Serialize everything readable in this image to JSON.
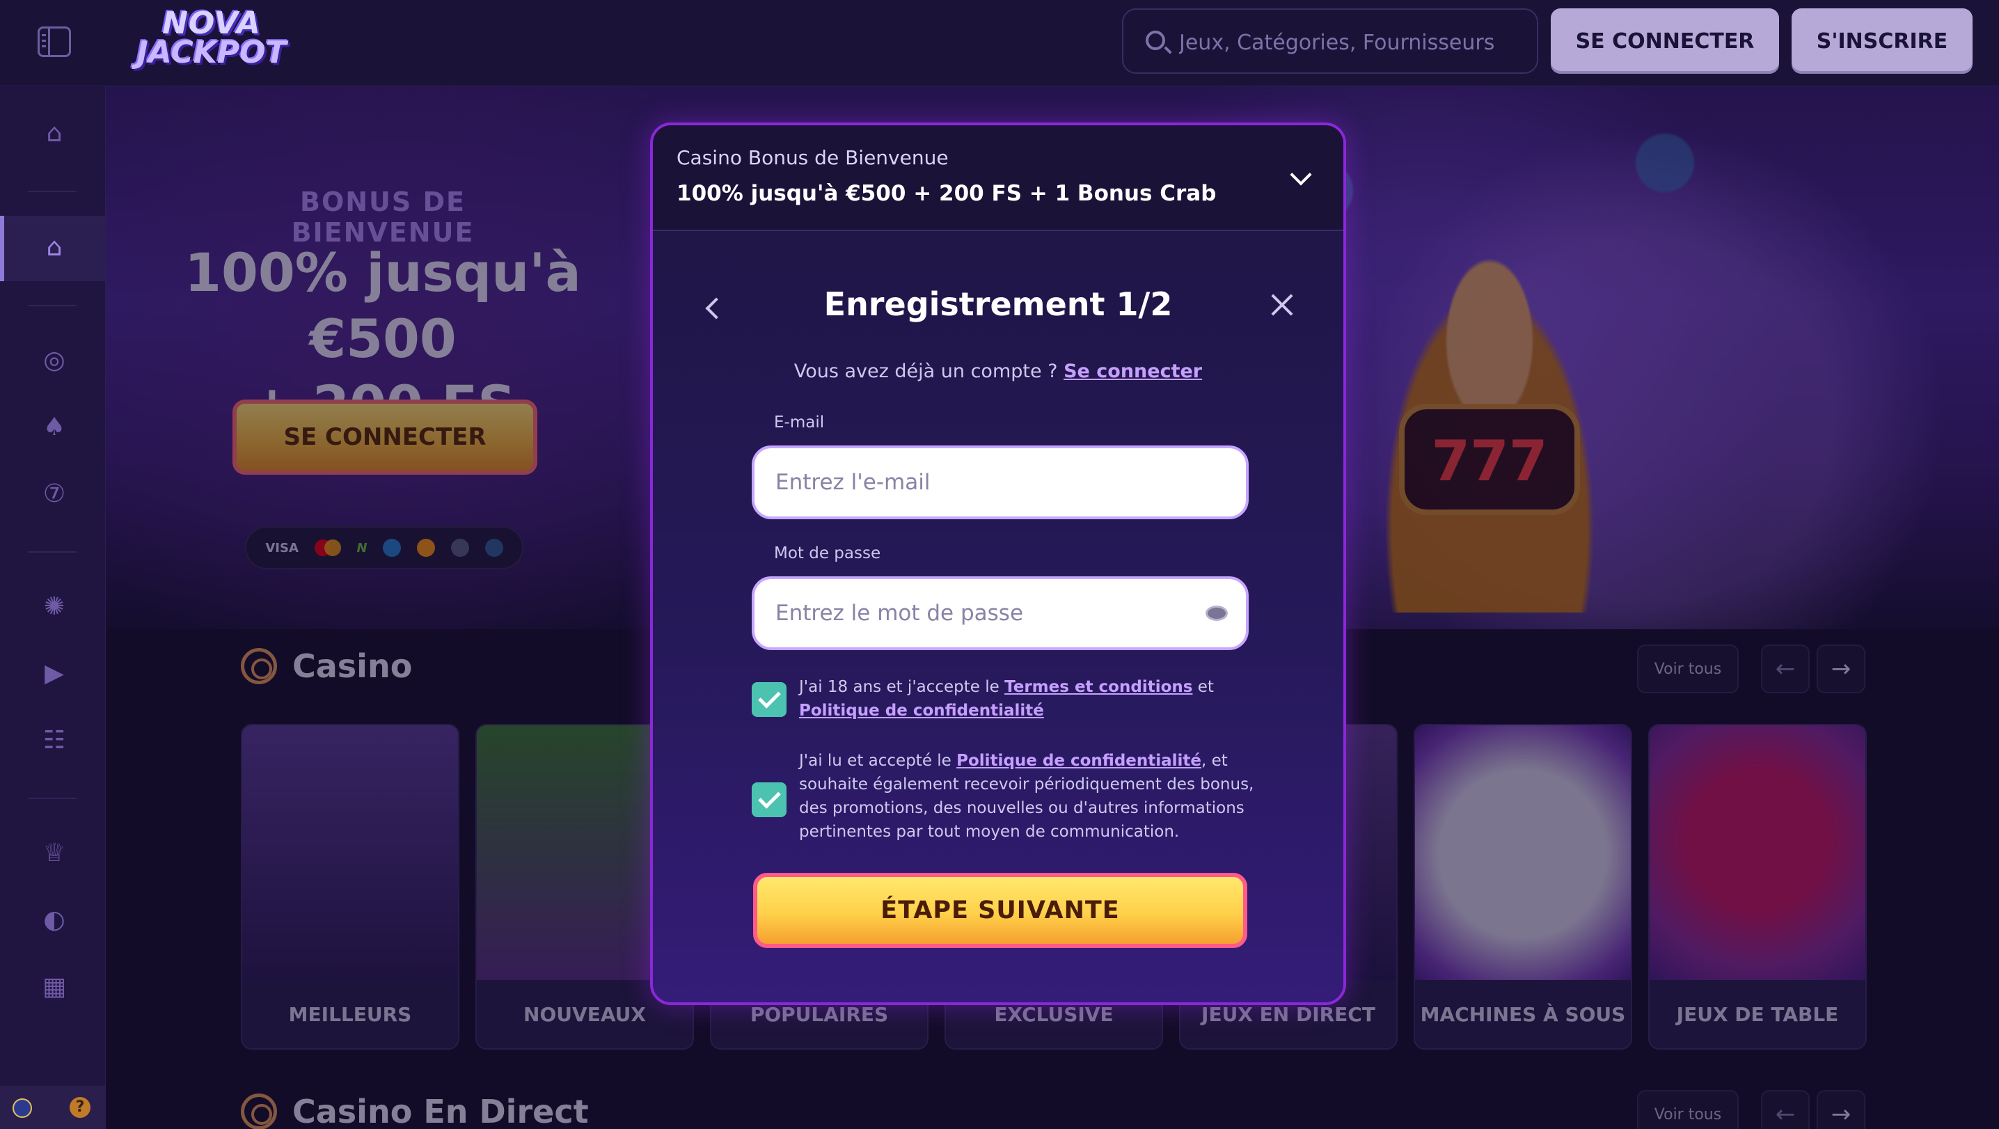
{
  "header": {
    "logo_line1": "NOVA",
    "logo_line2": "JACKPOT",
    "search_placeholder": "Jeux, Catégories, Fournisseurs",
    "login_label": "SE CONNECTER",
    "signup_label": "S'INSCRIRE"
  },
  "hero": {
    "bonus_title": "BONUS DE BIENVENUE",
    "bonus_amount_line1": "100% jusqu'à €500",
    "bonus_amount_line2": "+ 200 FS",
    "cta_label": "SE CONNECTER",
    "payments": [
      "VISA",
      "N"
    ],
    "slot_display": "777"
  },
  "sections": {
    "casino_title": "Casino",
    "live_title": "Casino En Direct",
    "see_all": "Voir tous"
  },
  "cards": [
    {
      "label": "MEILLEURS"
    },
    {
      "label": "NOUVEAUX"
    },
    {
      "label": "POPULAIRES"
    },
    {
      "label": "EXCLUSIVE"
    },
    {
      "label": "JEUX EN DIRECT"
    },
    {
      "label": "MACHINES À SOUS"
    },
    {
      "label": "JEUX DE TABLE"
    }
  ],
  "modal": {
    "bonus_label": "Casino Bonus de Bienvenue",
    "bonus_value": "100% jusqu'à €500 + 200 FS + 1 Bonus Crab",
    "title": "Enregistrement 1/2",
    "have_account": "Vous avez déjà un compte ?",
    "have_account_link": "Se connecter",
    "email_label": "E-mail",
    "email_placeholder": "Entrez l'e-mail",
    "password_label": "Mot de passe",
    "password_placeholder": "Entrez le mot de passe",
    "consent1_pre": "J'ai 18 ans et j'accepte le",
    "consent1_link1": "Termes et conditions",
    "consent1_mid": "et",
    "consent1_link2": "Politique de confidentialité",
    "consent2_pre": "J'ai lu et accepté le",
    "consent2_link": "Politique de confidentialité",
    "consent2_post": ", et souhaite également recevoir périodiquement des bonus, des promotions, des nouvelles ou d'autres informations pertinentes par tout moyen de communication.",
    "next_label": "ÉTAPE SUIVANTE"
  },
  "colors": {
    "background": "#1a1136",
    "accent_purple": "#8a28d8",
    "cta_yellow": "#ffd04a",
    "checkbox_teal": "#4cc3b0"
  }
}
